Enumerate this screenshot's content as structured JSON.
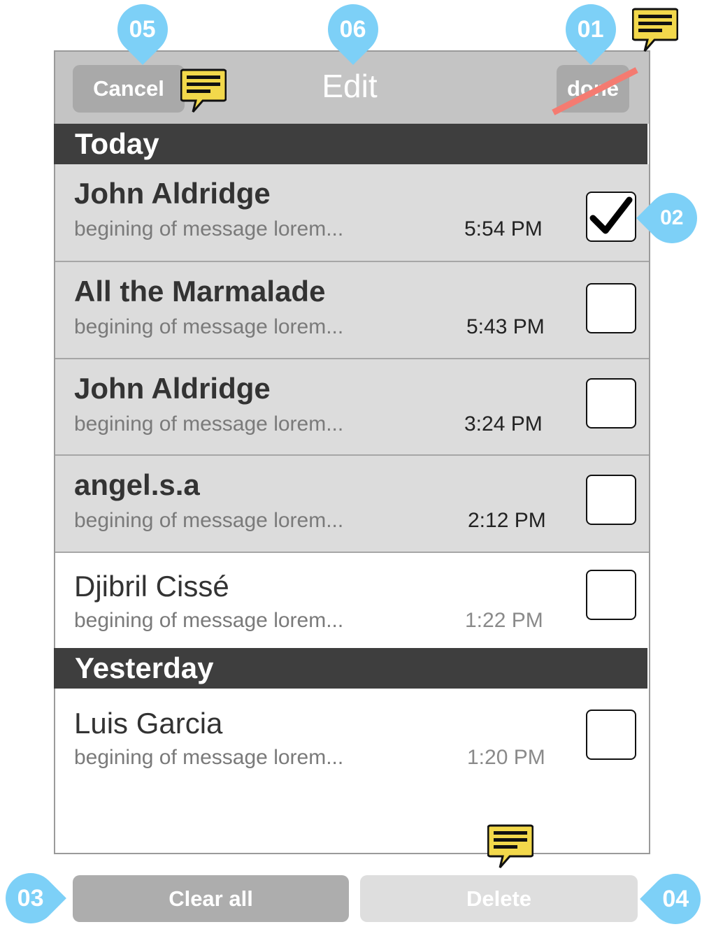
{
  "navbar": {
    "cancel_label": "Cancel",
    "title": "Edit",
    "done_label": "done"
  },
  "sections": {
    "today": "Today",
    "yesterday": "Yesterday"
  },
  "messages": [
    {
      "name": "John Aldridge",
      "preview": "begining of message lorem...",
      "time": "5:54 PM",
      "checked": true
    },
    {
      "name": "All the Marmalade",
      "preview": "begining of message lorem...",
      "time": "5:43 PM",
      "checked": false
    },
    {
      "name": "John Aldridge",
      "preview": "begining of message lorem...",
      "time": "3:24 PM",
      "checked": false
    },
    {
      "name": "angel.s.a",
      "preview": "begining of message lorem...",
      "time": "2:12 PM",
      "checked": false
    },
    {
      "name": "Djibril Cissé",
      "preview": "begining of message lorem...",
      "time": "1:22 PM",
      "checked": false
    },
    {
      "name": "Luis Garcia",
      "preview": "begining of message lorem...",
      "time": "1:20 PM",
      "checked": false
    }
  ],
  "footer": {
    "clear_all_label": "Clear all",
    "delete_label": "Delete"
  },
  "annotations": {
    "m01": "01",
    "m02": "02",
    "m03": "03",
    "m04": "04",
    "m05": "05",
    "m06": "06"
  },
  "colors": {
    "marker": "#7dd0f7",
    "note": "#f2d84b",
    "strike": "#f47b71",
    "section": "#3e3e3e"
  }
}
